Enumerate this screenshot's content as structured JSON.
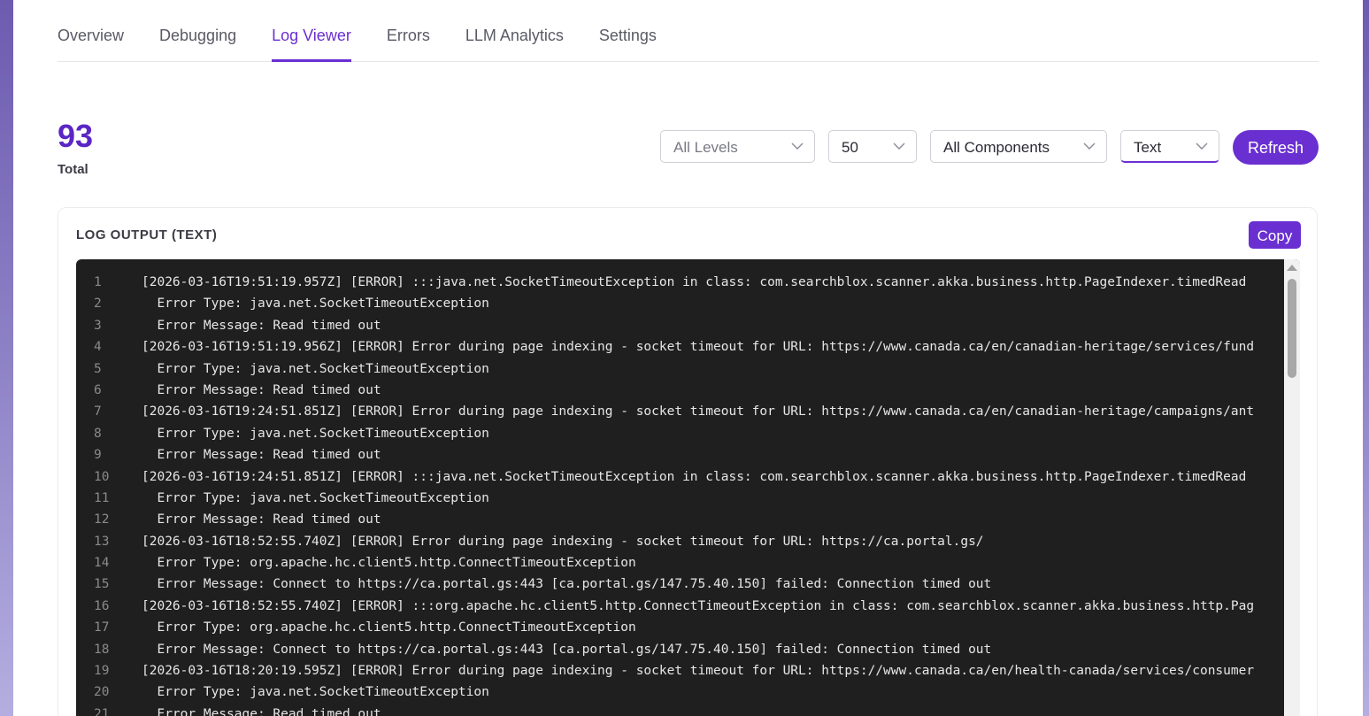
{
  "tabs": [
    {
      "label": "Overview",
      "active": false
    },
    {
      "label": "Debugging",
      "active": false
    },
    {
      "label": "Log Viewer",
      "active": true
    },
    {
      "label": "Errors",
      "active": false
    },
    {
      "label": "LLM Analytics",
      "active": false
    },
    {
      "label": "Settings",
      "active": false
    }
  ],
  "stats": {
    "total_value": "93",
    "total_label": "Total"
  },
  "filters": {
    "level": "All Levels",
    "limit": "50",
    "component": "All Components",
    "format": "Text"
  },
  "refresh_label": "Refresh",
  "log": {
    "title": "LOG OUTPUT (TEXT)",
    "copy_label": "Copy",
    "lines": [
      {
        "n": "1",
        "text": "[2026-03-16T19:51:19.957Z] [ERROR] :::java.net.SocketTimeoutException in class: com.searchblox.scanner.akka.business.http.PageIndexer.timedRead"
      },
      {
        "n": "2",
        "text": "  Error Type: java.net.SocketTimeoutException"
      },
      {
        "n": "3",
        "text": "  Error Message: Read timed out"
      },
      {
        "n": "4",
        "text": "[2026-03-16T19:51:19.956Z] [ERROR] Error during page indexing - socket timeout for URL: https://www.canada.ca/en/canadian-heritage/services/fund"
      },
      {
        "n": "5",
        "text": "  Error Type: java.net.SocketTimeoutException"
      },
      {
        "n": "6",
        "text": "  Error Message: Read timed out"
      },
      {
        "n": "7",
        "text": "[2026-03-16T19:24:51.851Z] [ERROR] Error during page indexing - socket timeout for URL: https://www.canada.ca/en/canadian-heritage/campaigns/ant"
      },
      {
        "n": "8",
        "text": "  Error Type: java.net.SocketTimeoutException"
      },
      {
        "n": "9",
        "text": "  Error Message: Read timed out"
      },
      {
        "n": "10",
        "text": "[2026-03-16T19:24:51.851Z] [ERROR] :::java.net.SocketTimeoutException in class: com.searchblox.scanner.akka.business.http.PageIndexer.timedRead"
      },
      {
        "n": "11",
        "text": "  Error Type: java.net.SocketTimeoutException"
      },
      {
        "n": "12",
        "text": "  Error Message: Read timed out"
      },
      {
        "n": "13",
        "text": "[2026-03-16T18:52:55.740Z] [ERROR] Error during page indexing - socket timeout for URL: https://ca.portal.gs/"
      },
      {
        "n": "14",
        "text": "  Error Type: org.apache.hc.client5.http.ConnectTimeoutException"
      },
      {
        "n": "15",
        "text": "  Error Message: Connect to https://ca.portal.gs:443 [ca.portal.gs/147.75.40.150] failed: Connection timed out"
      },
      {
        "n": "16",
        "text": "[2026-03-16T18:52:55.740Z] [ERROR] :::org.apache.hc.client5.http.ConnectTimeoutException in class: com.searchblox.scanner.akka.business.http.Pag"
      },
      {
        "n": "17",
        "text": "  Error Type: org.apache.hc.client5.http.ConnectTimeoutException"
      },
      {
        "n": "18",
        "text": "  Error Message: Connect to https://ca.portal.gs:443 [ca.portal.gs/147.75.40.150] failed: Connection timed out"
      },
      {
        "n": "19",
        "text": "[2026-03-16T18:20:19.595Z] [ERROR] Error during page indexing - socket timeout for URL: https://www.canada.ca/en/health-canada/services/consumer"
      },
      {
        "n": "20",
        "text": "  Error Type: java.net.SocketTimeoutException"
      },
      {
        "n": "21",
        "text": "  Error Message: Read timed out"
      }
    ]
  },
  "colors": {
    "accent": "#6a2fd1",
    "stat": "#5b26c4",
    "log_bg": "#1f1f1f"
  }
}
